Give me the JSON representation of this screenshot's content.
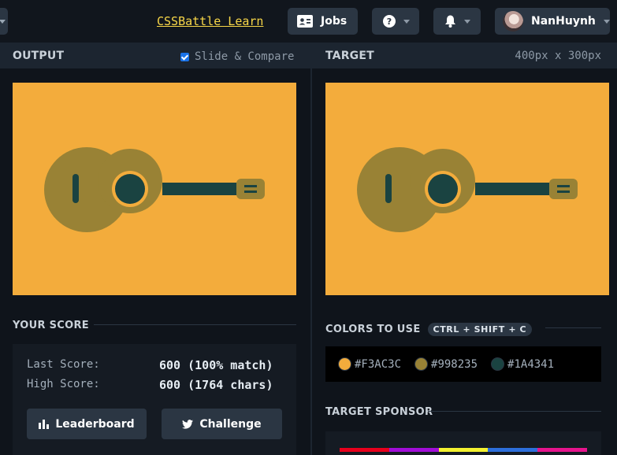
{
  "topbar": {
    "learn_link": "CSSBattle Learn",
    "jobs_label": "Jobs",
    "username": "NanHuynh"
  },
  "output": {
    "title": "OUTPUT",
    "slide_compare_label": "Slide & Compare",
    "slide_compare_checked": true
  },
  "target": {
    "title": "TARGET",
    "dimensions": "400px x 300px"
  },
  "score": {
    "title": "YOUR SCORE",
    "last_label": "Last Score:",
    "last_value": "600 (100% match)",
    "high_label": "High Score:",
    "high_value": "600 (1764 chars)",
    "leaderboard_label": "Leaderboard",
    "challenge_label": "Challenge"
  },
  "colors": {
    "title": "COLORS TO USE",
    "shortcut": "CTRL + SHIFT + C",
    "swatches": [
      {
        "code": "#F3AC3C",
        "color": "#F3AC3C"
      },
      {
        "code": "#998235",
        "color": "#998235"
      },
      {
        "code": "#1A4341",
        "color": "#1A4341"
      }
    ]
  },
  "sponsor": {
    "title": "TARGET SPONSOR",
    "rainbow": [
      "#e8001c",
      "#a10dd8",
      "#f4f230",
      "#2d6fdc",
      "#e6148d"
    ]
  },
  "icons": {
    "jobs": "id-card-icon",
    "help": "question-circle-icon",
    "notifications": "bell-icon",
    "leaderboard": "bar-chart-icon",
    "challenge": "twitter-icon"
  }
}
